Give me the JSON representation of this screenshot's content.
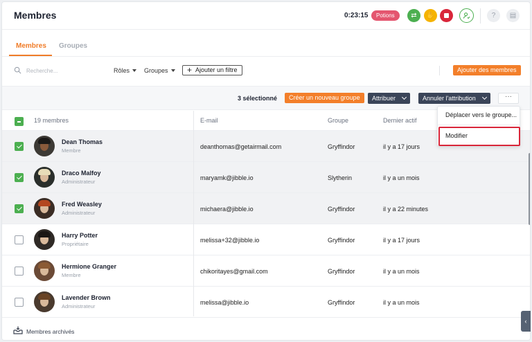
{
  "header": {
    "title": "Membres",
    "timer": "0:23:15",
    "activity_badge": "Potions",
    "icons": [
      "switch-activity-icon",
      "hand-icon",
      "stop-icon",
      "user-check-icon",
      "help-icon",
      "stats-icon"
    ],
    "colors": {
      "accent": "#f37f2a",
      "green": "#4caf50",
      "yellow": "#f5b301",
      "red": "#d9263a",
      "badge": "#e4566f"
    }
  },
  "tabs": [
    {
      "label": "Membres",
      "active": true
    },
    {
      "label": "Groupes",
      "active": false
    }
  ],
  "filters": {
    "search_placeholder": "Recherche...",
    "roles_label": "Rôles",
    "group_label": "Groupes",
    "add_filter_label": "Ajouter un filtre",
    "add_members_label": "Ajouter des membres"
  },
  "bulk_actions": {
    "selected_count": "3 sélectionné",
    "create_group_label": "Créer un nouveau groupe",
    "assign_label": "Attribuer",
    "unassign_label": "Annuler l'attribution",
    "more_label": "···"
  },
  "menu": {
    "items": [
      "Déplacer vers le groupe...",
      "Modifier"
    ],
    "highlighted": "Modifier"
  },
  "table": {
    "headers": {
      "count": "19 membres",
      "email": "E-mail",
      "group": "Groupe",
      "last_active": "Dernier actif"
    },
    "rows": [
      {
        "name": "Dean Thomas",
        "role": "Membre",
        "email": "deanthomas@getairmail.com",
        "group": "Gryffindor",
        "last_active": "il y a 17 jours",
        "selected": true
      },
      {
        "name": "Draco Malfoy",
        "role": "Administrateur",
        "email": "maryamk@jibble.io",
        "group": "Slytherin",
        "last_active": "il y a un mois",
        "selected": true
      },
      {
        "name": "Fred Weasley",
        "role": "Administrateur",
        "email": "michaera@jibble.io",
        "group": "Gryffindor",
        "last_active": "il y a 22 minutes",
        "selected": true
      },
      {
        "name": "Harry Potter",
        "role": "Propriétaire",
        "email": "melissa+32@jibble.io",
        "group": "Gryffindor",
        "last_active": "il y a 17 jours",
        "selected": false
      },
      {
        "name": "Hermione Granger",
        "role": "Membre",
        "email": "chikoritayes@gmail.com",
        "group": "Gryffindor",
        "last_active": "il y a un mois",
        "selected": false
      },
      {
        "name": "Lavender Brown",
        "role": "Administrateur",
        "email": "melissa@jibble.io",
        "group": "Gryffindor",
        "last_active": "il y a un mois",
        "selected": false
      }
    ]
  },
  "footer": {
    "archived_label": "Membres archivés"
  }
}
